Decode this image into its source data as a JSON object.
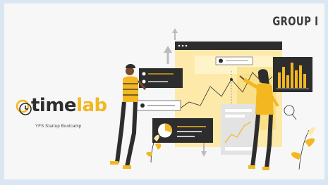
{
  "slide": {
    "group_label": "GROUP I",
    "logo": {
      "part1": "time",
      "part2": "lab",
      "icon": "clock-logo-icon"
    },
    "subtitle": "YFS Startup Bootcamp"
  },
  "colors": {
    "background": "#dbe6f3",
    "slide": "#f7f7f7",
    "accent_yellow": "#f2b721",
    "dark": "#2d2d2d"
  },
  "illustration": "people-with-data-dashboards-illustration"
}
